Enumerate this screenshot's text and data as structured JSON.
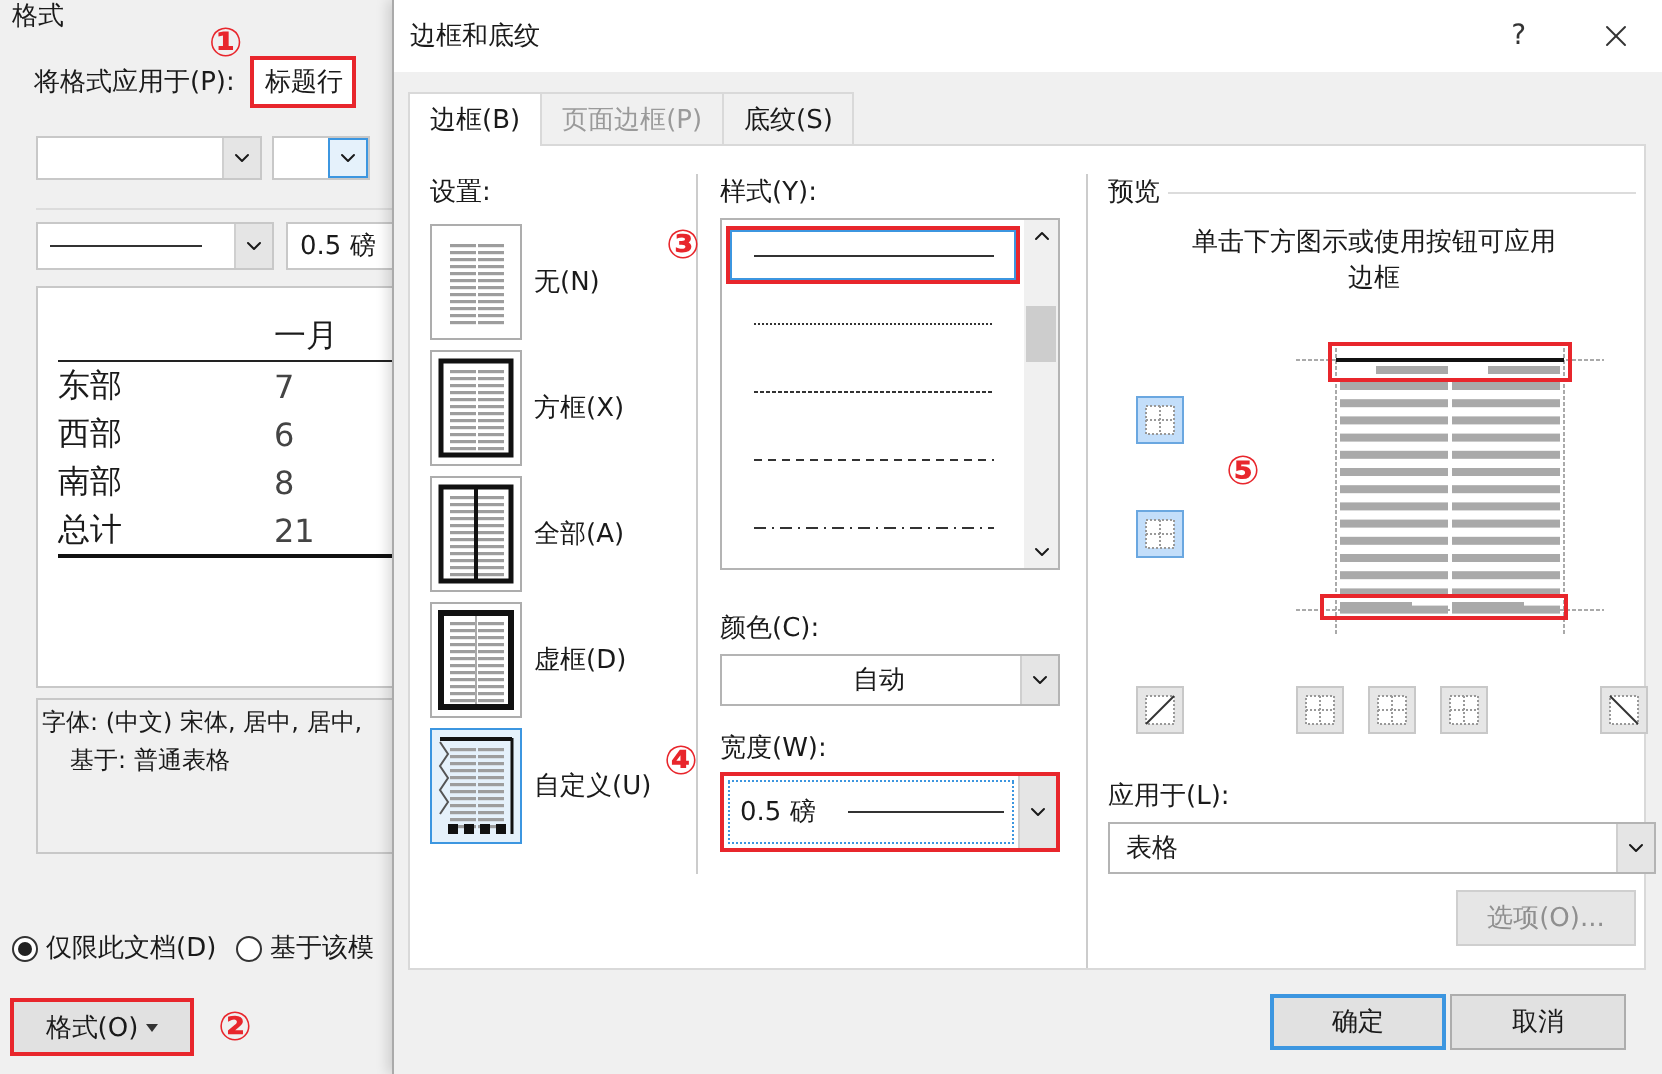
{
  "background_dialog": {
    "group_label": "格式",
    "apply_to": {
      "label": "将格式应用于(P):",
      "value": "标题行",
      "highlighted": true,
      "marker": "①"
    },
    "line_width": "0.5 磅",
    "sample_table": {
      "header": "一月",
      "rows": [
        {
          "name": "东部",
          "value": "7"
        },
        {
          "name": "西部",
          "value": "6"
        },
        {
          "name": "南部",
          "value": "8"
        },
        {
          "name": "总计",
          "value": "21"
        }
      ]
    },
    "description": [
      "字体: (中文) 宋体, 居中, 居中,",
      "基于: 普通表格"
    ],
    "save_options": [
      {
        "label": "仅限此文档(D)",
        "selected": true
      },
      {
        "label": "基于该模",
        "selected": false
      }
    ],
    "format_button": {
      "label": "格式(O)",
      "highlighted": true,
      "marker": "②"
    }
  },
  "dialog": {
    "title": "边框和底纹",
    "help": "?",
    "tabs": [
      {
        "label": "边框(B)",
        "selected": true,
        "disabled": false
      },
      {
        "label": "页面边框(P)",
        "selected": false,
        "disabled": true
      },
      {
        "label": "底纹(S)",
        "selected": false,
        "disabled": false
      }
    ],
    "settings": {
      "label": "设置:",
      "items": [
        {
          "label": "无(N)",
          "kind": "none",
          "selected": false
        },
        {
          "label": "方框(X)",
          "kind": "box",
          "selected": false
        },
        {
          "label": "全部(A)",
          "kind": "all",
          "selected": false
        },
        {
          "label": "虚框(D)",
          "kind": "grid",
          "selected": false
        },
        {
          "label": "自定义(U)",
          "kind": "custom",
          "selected": true
        }
      ]
    },
    "style": {
      "label": "样式(Y):",
      "marker": "③",
      "options": [
        {
          "kind": "solid",
          "selected": true,
          "highlighted": true
        },
        {
          "kind": "dotted",
          "selected": false,
          "highlighted": false
        },
        {
          "kind": "fine-dash",
          "selected": false,
          "highlighted": false
        },
        {
          "kind": "dash",
          "selected": false,
          "highlighted": false
        },
        {
          "kind": "dash-dot",
          "selected": false,
          "highlighted": false
        }
      ]
    },
    "color": {
      "label": "颜色(C):",
      "value": "自动"
    },
    "width": {
      "label": "宽度(W):",
      "value": "0.5 磅",
      "highlighted": true,
      "marker": "④"
    },
    "preview": {
      "label": "预览",
      "hint": "单击下方图示或使用按钮可应用边框",
      "marker": "⑤",
      "top_border_highlighted": true,
      "bottom_border_highlighted": true
    },
    "apply_to": {
      "label": "应用于(L):",
      "value": "表格"
    },
    "options_button": {
      "label": "选项(O)...",
      "disabled": true
    },
    "buttons": [
      {
        "label": "确定",
        "default": true
      },
      {
        "label": "取消",
        "default": false
      }
    ]
  }
}
